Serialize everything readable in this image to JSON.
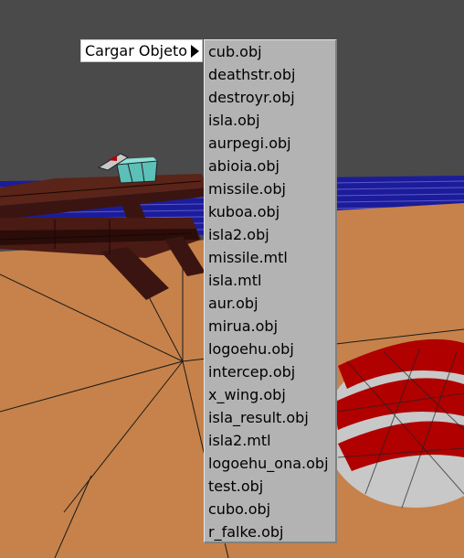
{
  "menu": {
    "parent_label": "Cargar Objeto",
    "items": [
      "cub.obj",
      "deathstr.obj",
      "destroyr.obj",
      "isla.obj",
      "aurpegi.obj",
      "abioia.obj",
      "missile.obj",
      "kuboa.obj",
      "isla2.obj",
      "missile.mtl",
      "isla.mtl",
      "aur.obj",
      "mirua.obj",
      "logoehu.obj",
      "intercep.obj",
      "x_wing.obj",
      "isla_result.obj",
      "isla2.mtl",
      "logoehu_ona.obj",
      "test.obj",
      "cubo.obj",
      "r_falke.obj"
    ]
  },
  "colors": {
    "sky": "#4a4a4a",
    "sand": "#c48048",
    "water": "#1a1a8c",
    "wood": "#4a1a14",
    "menu_bg": "#b3b3b3",
    "stripe_red": "#b00000",
    "stripe_white": "#c8c8c8"
  }
}
